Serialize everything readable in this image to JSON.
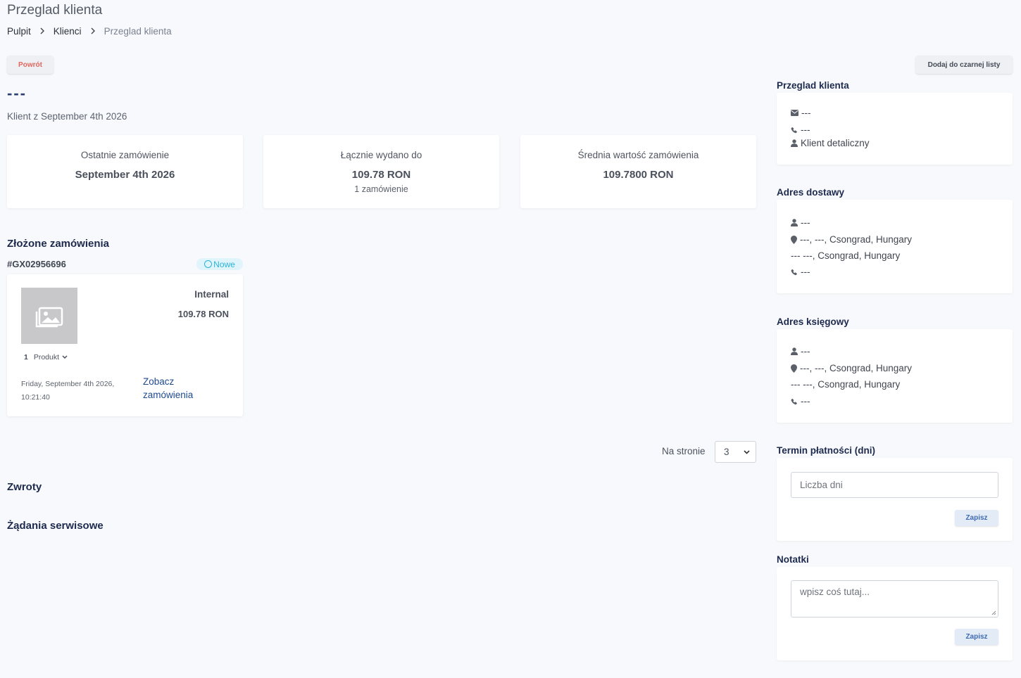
{
  "header": {
    "title": "Przeglad klienta",
    "breadcrumb": [
      "Pulpit",
      "Klienci",
      "Przeglad klienta"
    ]
  },
  "actions": {
    "back_label": "Powrót",
    "blacklist_label": "Dodaj do czarnej listy"
  },
  "customer": {
    "name": "---",
    "since": "Klient z September 4th 2026"
  },
  "stats": [
    {
      "label": "Ostatnie zamówienie",
      "value": "September 4th 2026",
      "sub": ""
    },
    {
      "label": "Łącznie wydano do",
      "value": "109.78 RON",
      "sub": "1 zamówienie"
    },
    {
      "label": "Średnia wartość zamówienia",
      "value": "109.7800 RON",
      "sub": ""
    }
  ],
  "orders": {
    "title": "Złożone zamówienia",
    "items": [
      {
        "id": "#GX02956696",
        "status": "Nowe",
        "source": "Internal",
        "amount": "109.78 RON",
        "product_count": "1",
        "product_label": "Produkt",
        "date_line1": "Friday, September 4th 2026,",
        "date_line2": "10:21:40",
        "link_line1": "Zobacz",
        "link_line2": "zamówienia"
      }
    ]
  },
  "pagination": {
    "per_page_label": "Na stronie",
    "per_page_value": "3"
  },
  "returns_title": "Zwroty",
  "service_title": "Żądania serwisowe",
  "sidebar": {
    "overview": {
      "title": "Przeglad klienta",
      "email": "---",
      "phone": "---",
      "type": "Klient detaliczny"
    },
    "shipping": {
      "title": "Adres dostawy",
      "name": "---",
      "address1": "---, ---, Csongrad, Hungary",
      "address2": "--- ---, Csongrad, Hungary",
      "phone": "---"
    },
    "billing": {
      "title": "Adres księgowy",
      "name": "---",
      "address1": "---, ---, Csongrad, Hungary",
      "address2": "--- ---, Csongrad, Hungary",
      "phone": "---"
    },
    "payment_terms": {
      "title": "Termin płatności (dni)",
      "placeholder": "Liczba dni",
      "save_label": "Zapisz"
    },
    "notes": {
      "title": "Notatki",
      "placeholder": "wpisz coś tutaj...",
      "save_label": "Zapisz"
    }
  },
  "colors": {
    "background": "#f7f9fc",
    "heading": "#1d2a4d",
    "danger": "#e2665e",
    "link": "#1d4a8f",
    "badge": "#2bb3da"
  },
  "icons": [
    "chevron-right-icon",
    "image-icon",
    "chevron-down-icon",
    "envelope-icon",
    "phone-icon",
    "user-icon",
    "map-pin-icon"
  ]
}
